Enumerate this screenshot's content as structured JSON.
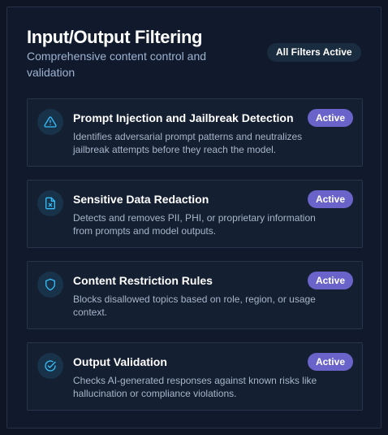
{
  "header": {
    "title": "Input/Output Filtering",
    "subtitle": "Comprehensive content control and validation",
    "status_badge": "All Filters Active"
  },
  "theme": {
    "accent": "#6a63c9",
    "icon_color": "#38bdf8"
  },
  "filters": [
    {
      "icon": "warning-triangle-icon",
      "title": "Prompt Injection and Jailbreak Detection",
      "description": "Identifies adversarial prompt patterns and neutralizes jailbreak attempts before they reach the model.",
      "status": "Active"
    },
    {
      "icon": "redacted-document-icon",
      "title": "Sensitive Data Redaction",
      "description": "Detects and removes PII, PHI, or proprietary information from prompts and model outputs.",
      "status": "Active"
    },
    {
      "icon": "shield-icon",
      "title": "Content Restriction Rules",
      "description": "Blocks disallowed topics based on role, region, or usage context.",
      "status": "Active"
    },
    {
      "icon": "check-circle-icon",
      "title": "Output Validation",
      "description": "Checks AI-generated responses against known risks like hallucination or compliance violations.",
      "status": "Active"
    }
  ]
}
